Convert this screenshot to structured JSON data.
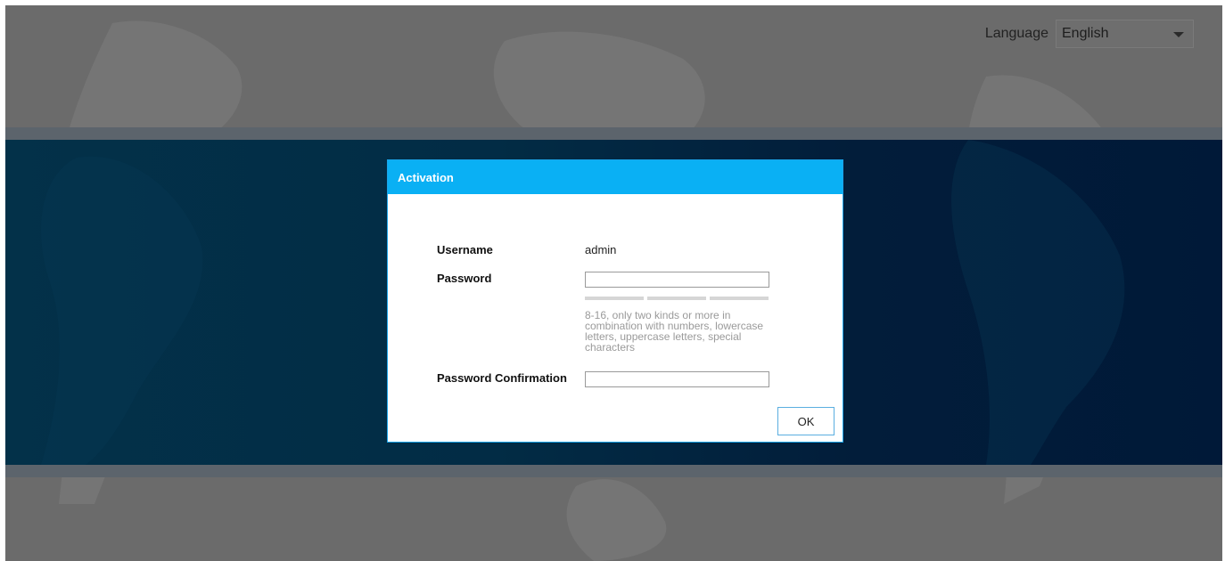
{
  "language": {
    "label": "Language",
    "selected": "English"
  },
  "dialog": {
    "title": "Activation",
    "username_label": "Username",
    "username_value": "admin",
    "password_label": "Password",
    "password_value": "",
    "password_hint": "8-16, only two kinds or more in combination with numbers, lowercase letters, uppercase letters, special characters",
    "password_strength_segments": 3,
    "confirm_label": "Password Confirmation",
    "confirm_value": "",
    "ok_label": "OK"
  },
  "colors": {
    "header": "#0ab0f4",
    "band": "#022c45",
    "overlay": "#6b6b6b"
  }
}
